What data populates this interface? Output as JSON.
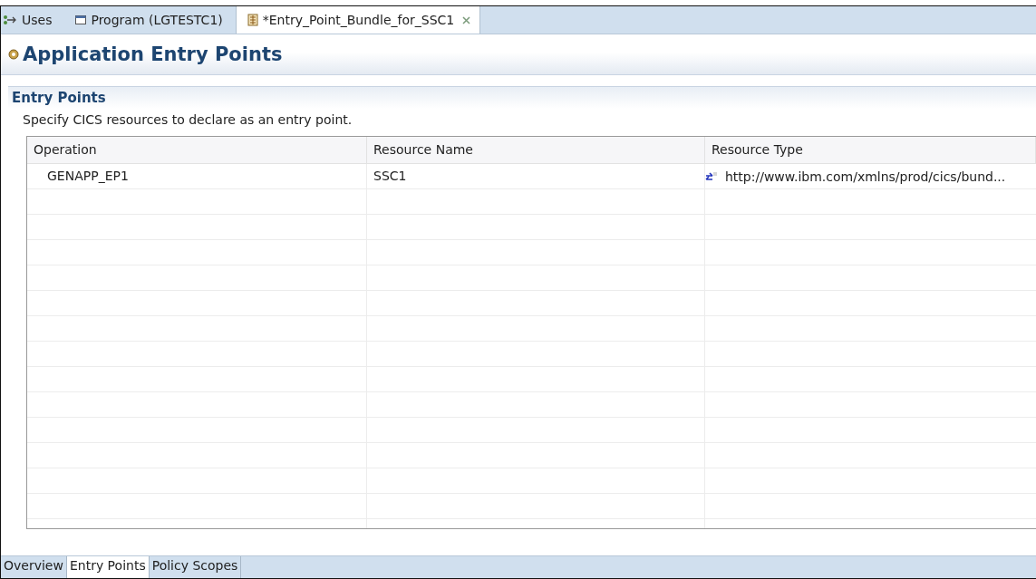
{
  "editor_tabs": [
    {
      "label": "Uses",
      "kind": "uses",
      "selected": false
    },
    {
      "label": "Program (LGTESTC1)",
      "kind": "program",
      "selected": false
    },
    {
      "label": "*Entry_Point_Bundle_for_SSC1",
      "kind": "bundle",
      "selected": true
    }
  ],
  "page_title": "Application Entry Points",
  "section": {
    "title": "Entry Points",
    "description": "Specify CICS resources to declare as an entry point."
  },
  "table": {
    "columns": [
      "Operation",
      "Resource Name",
      "Resource Type"
    ],
    "rows": [
      {
        "operation": "GENAPP_EP1",
        "resource_name": "SSC1",
        "resource_type": "http://www.ibm.com/xmlns/prod/cics/bund..."
      }
    ]
  },
  "page_tabs": [
    {
      "label": "Overview",
      "selected": false
    },
    {
      "label": "Entry Points",
      "selected": true
    },
    {
      "label": "Policy Scopes",
      "selected": false
    }
  ]
}
